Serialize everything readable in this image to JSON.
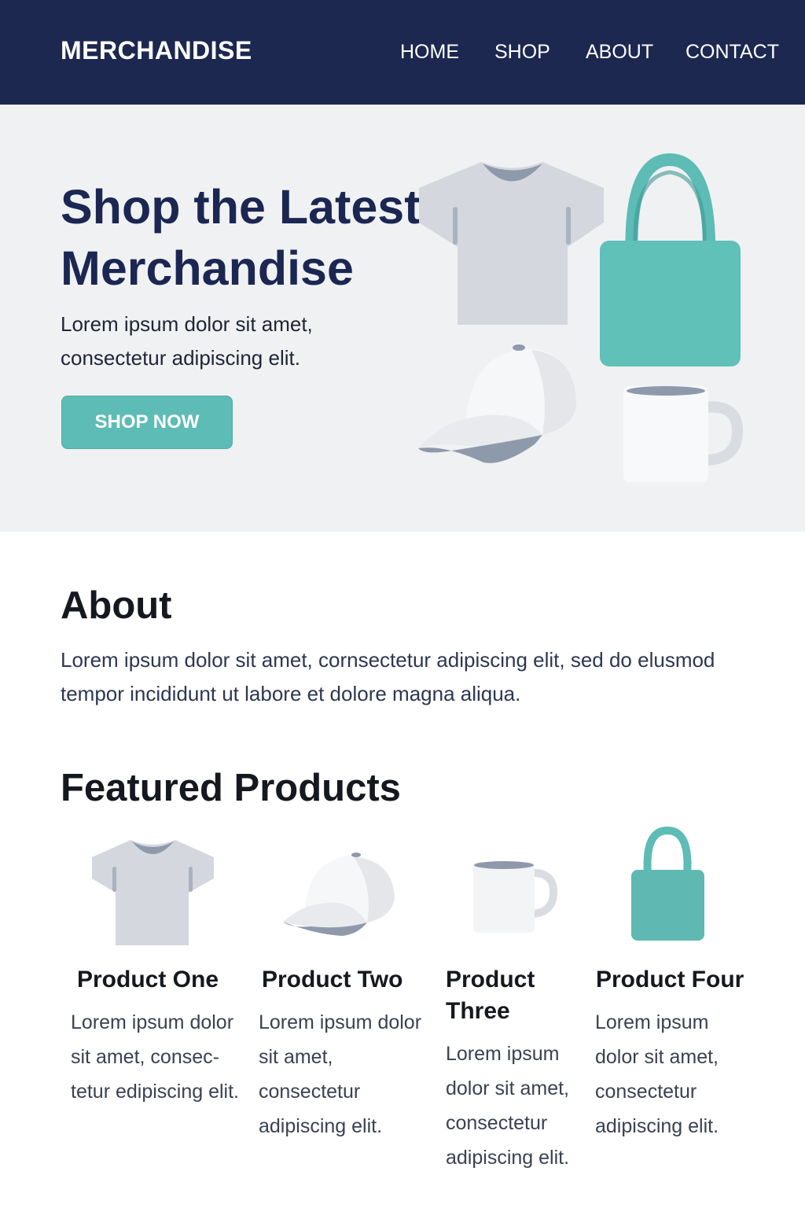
{
  "header": {
    "brand": "MERCHANDISE",
    "nav": [
      "HOME",
      "SHOP",
      "ABOUT",
      "CONTACT"
    ]
  },
  "hero": {
    "title": "Shop the Latest\nMerchandise",
    "subtitle": "Lorem ipsum dolor sit amet,\nconsectetur adipiscing elit.",
    "cta": "SHOP NOW",
    "illustrations": [
      "t-shirt-icon",
      "tote-bag-icon",
      "cap-icon",
      "mug-icon"
    ]
  },
  "about": {
    "title": "About",
    "text": "Lorem ipsum dolor sit amet, cornsectetur adipiscing elit, sed do elusmod tempor incididunt ut labore et dolore magna aliqua."
  },
  "featured": {
    "title": "Featured Products",
    "products": [
      {
        "name": "Product One",
        "desc": "Lorem ipsum dolor sit amet, consec-tetur edipiscing elit.",
        "icon": "t-shirt-icon"
      },
      {
        "name": "Product Two",
        "desc": "Lorem ipsum dolor sit amet, consectetur adipiscing elit.",
        "icon": "cap-icon"
      },
      {
        "name": "Product Three",
        "desc": "Lorem ipsum dolor sit amet, consectetur adipiscing elit.",
        "icon": "mug-icon"
      },
      {
        "name": "Product Four",
        "desc": "Lorem ipsum dolor sit amet, consectetur adipiscing elit.",
        "icon": "tote-bag-icon"
      }
    ]
  },
  "colors": {
    "navy": "#1c2850",
    "teal": "#5dbcb5",
    "hero_bg": "#f0f1f3",
    "gray": "#d4d7dd",
    "slate": "#8e9aab"
  }
}
